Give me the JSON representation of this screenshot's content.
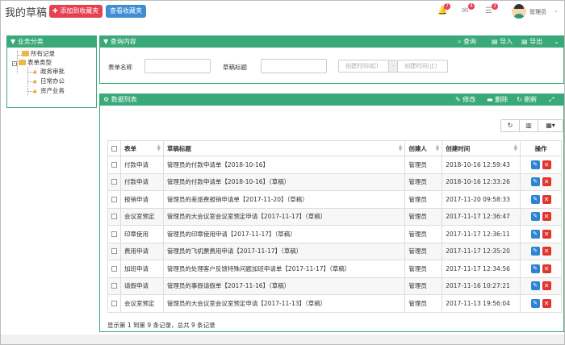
{
  "page": {
    "title": "我的草稿"
  },
  "topbar": {
    "add_button": "添加到收藏夹",
    "view_button": "查看收藏夹",
    "bell_badge": "7",
    "mail_badge": "4",
    "task_badge": "3",
    "user_name": "管理员"
  },
  "left_panel": {
    "header": "业务分类",
    "items": [
      "所有记录",
      "表单类型",
      "政务审批",
      "日常办公",
      "资产业务"
    ]
  },
  "query_panel": {
    "header": "查询内容",
    "query_btn": "查询",
    "import_btn": "导入",
    "export_btn": "导出",
    "form_name_label": "表单名称",
    "draft_title_label": "草稿标题",
    "date_start_placeholder": "创建时间(起)",
    "date_sep": "-",
    "date_end_placeholder": "创建时间(止)"
  },
  "data_panel": {
    "header": "数据列表",
    "edit_btn": "修改",
    "delete_btn": "删除",
    "refresh_btn": "刷新",
    "columns": [
      "表单",
      "草稿标题",
      "创建人",
      "创建时间",
      "操作"
    ],
    "rows": [
      [
        "付款申请",
        "管理员的付款申请单【2018-10-16】",
        "管理员",
        "2018-10-16 12:59:43"
      ],
      [
        "付款申请",
        "管理员的付款申请单【2018-10-16】（草稿）",
        "管理员",
        "2018-10-16 12:33:26"
      ],
      [
        "报销申请",
        "管理员的差旅费报销申请单【2017-11-20】（草稿）",
        "管理员",
        "2017-11-20 09:58:33"
      ],
      [
        "会议室预定",
        "管理员的大会议室会议室预定申请【2017-11-17】（草稿）",
        "管理员",
        "2017-11-17 12:36:47"
      ],
      [
        "印章使用",
        "管理员的印章使用申请【2017-11-17】（草稿）",
        "管理员",
        "2017-11-17 12:36:11"
      ],
      [
        "费用申请",
        "管理员的飞机票费用申请【2017-11-17】（草稿）",
        "管理员",
        "2017-11-17 12:35:20"
      ],
      [
        "加班申请",
        "管理员的处理客户反馈特殊问题加班申请单【2017-11-17】（草稿）",
        "管理员",
        "2017-11-17 12:34:56"
      ],
      [
        "请假申请",
        "管理员的事假请假单【2017-11-16】（草稿）",
        "管理员",
        "2017-11-16 10:27:21"
      ],
      [
        "会议室预定",
        "管理员的大会议室会议室预定申请【2017-11-13】（草稿）",
        "管理员",
        "2017-11-13 19:56:04"
      ]
    ],
    "footer": "显示第 1 到第 9 条记录，总共 9 条记录"
  },
  "colors": {
    "accent": "#39a979",
    "add_btn": "#e64150",
    "view_btn": "#3f8ed4",
    "edit_icon": "#2c84d3",
    "delete_icon": "#e0352b"
  }
}
